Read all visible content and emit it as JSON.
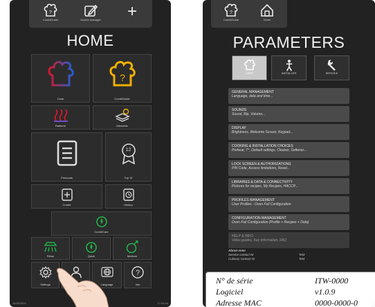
{
  "left": {
    "toolbar": {
      "combiguide_label": "CombiGuide",
      "screen_manager_label": "Screen manager",
      "add_symbol": "+"
    },
    "title": "HOME",
    "tiles": {
      "cook": "Cook",
      "combiguide": "CombiGuide",
      "ratherm": "Ratherm",
      "menumix": "MenuMix",
      "protocols": "Protocols",
      "top12": "Top 12",
      "top12_number": "12",
      "create": "Create",
      "history": "History",
      "combicare": "CombiCare",
      "rinse": "Rinse",
      "quick": "Quick",
      "medium": "Medium",
      "settings": "Settings",
      "user": "",
      "language": "Language",
      "info": "Info"
    },
    "footer": {
      "date": "11/06/2024",
      "time": "17:44:44"
    }
  },
  "right": {
    "toolbar": {
      "combiguide_label": "CombiGuide",
      "home_label": "Home"
    },
    "title": "PARAMETERS",
    "tabs": {
      "user": "USER",
      "installer": "INSTALLER",
      "service": "SERVICE"
    },
    "menu": [
      {
        "title": "GENERAL MANAGEMENT",
        "sub": "Language, data and time..."
      },
      {
        "title": "SOUNDS",
        "sub": "Sound, Bip, Volume..."
      },
      {
        "title": "DISPLAY",
        "sub": "Brightness, Welcome Screen, Keypad..."
      },
      {
        "title": "COOKING & INSTALLATION CHOICES",
        "sub": "Preheat, T°, Default settings, Cleaner, Softener..."
      },
      {
        "title": "LOCK SCREEN & AUTHORIZATIONS",
        "sub": "PIN Code, Access limitations, Reset..."
      },
      {
        "title": "LIBRARIES & DATA & CONNECTIVITY",
        "sub": "Pictures for recipes, My Recipes, HACCP..."
      },
      {
        "title": "PROFILES MANAGEMENT",
        "sub": "User Profiles - Oven Full Configuration"
      },
      {
        "title": "CONFIGURATION MANAGEMENT",
        "sub": "Oven Full Configuration (Profile + Recipes + Data)"
      },
      {
        "title": "HELP & INFO",
        "sub": "Video guides, Key information, FAQ"
      }
    ],
    "about": {
      "heading": "About oven",
      "service_label": "Service contact Nr",
      "service_value": "Tel3",
      "culinary_label": "Culinary contact Nr",
      "culinary_value": "Tel4"
    },
    "info": {
      "serial_label": "N° de série",
      "serial_value": "ITW-0000",
      "software_label": "Logiciel",
      "software_value": "v1.0.9",
      "mac_label": "Adresse MAC",
      "mac_value": "0000-0000-0"
    }
  },
  "colors": {
    "cook_red": "#d4182c",
    "cook_blue": "#1f5fd6",
    "guide_yellow": "#f0b000",
    "green": "#22b34a",
    "ratherm_red": "#d4182c"
  }
}
